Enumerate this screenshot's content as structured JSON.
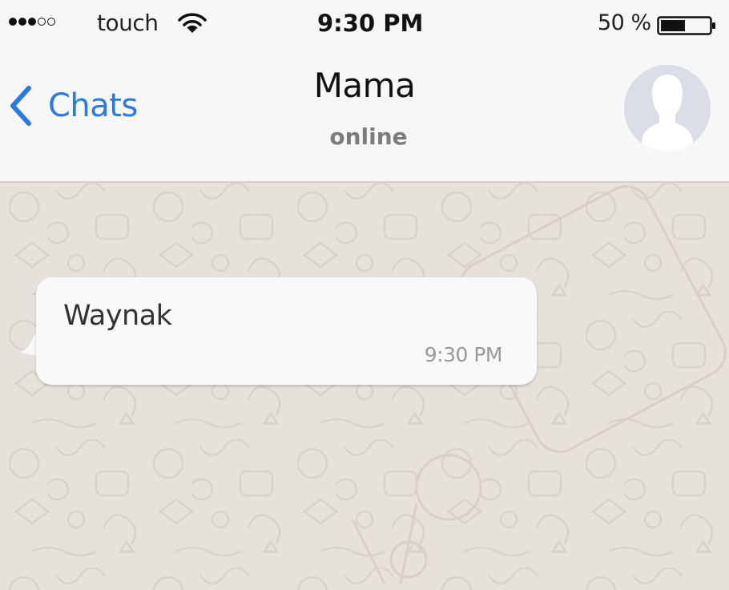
{
  "status_bar": {
    "carrier": "touch",
    "time": "9:30 PM",
    "battery_percent": "50 %",
    "battery_level": 0.5,
    "signal_bars_filled": 3,
    "signal_bars_total": 5,
    "icons": [
      "wifi-icon",
      "battery-icon"
    ]
  },
  "nav": {
    "back_label": "Chats",
    "back_icon": "chevron-left-icon",
    "contact_name": "Mama",
    "contact_status": "online",
    "avatar_icon": "person-silhouette-icon"
  },
  "messages": [
    {
      "text": "Waynak",
      "time": "9:30 PM",
      "direction": "incoming"
    }
  ],
  "colors": {
    "accent": "#2a7ae2",
    "bar_background": "#f7f7f7",
    "chat_background": "#e6e2db",
    "bubble_background": "#f9f9f9",
    "status_gray": "#7c7c7c"
  }
}
